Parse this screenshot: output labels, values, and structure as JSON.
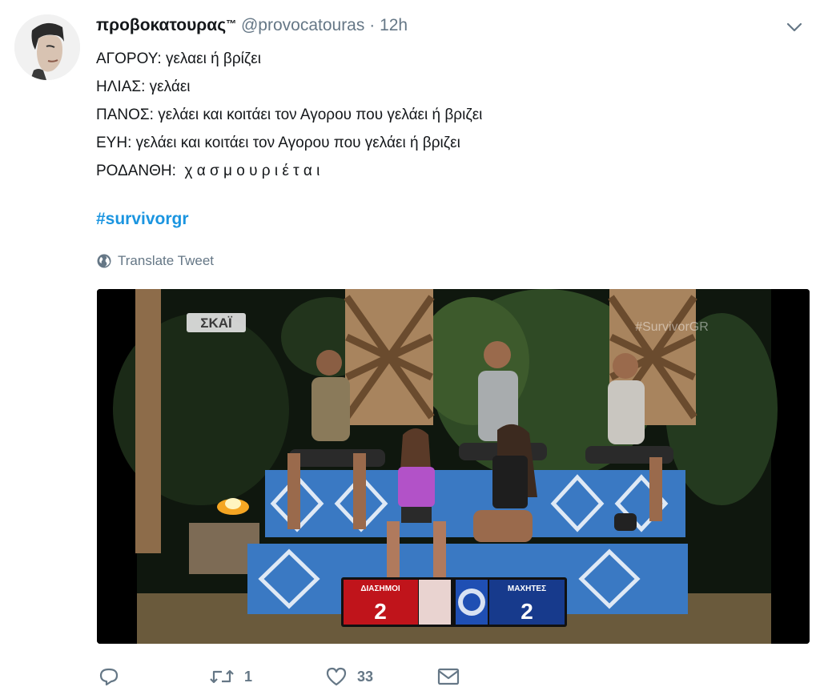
{
  "tweet": {
    "display_name": "προβοκατουρας",
    "trademark": "™",
    "handle": "@provocatouras",
    "separator": "·",
    "time": "12h",
    "lines": [
      "ΑΓΟΡΟΥ: γελαει ή βρίζει",
      "ΗΛΙΑΣ: γελάει",
      "ΠΑΝΟΣ: γελάει και κοιτάει τον Αγορου που γελάει ή βριζει",
      "ΕΥΗ: γελάει και κοιτάει τον Αγορου που γελάει ή βριζει",
      "ΡΟΔΑΝΘΗ:  χ α σ μ ο υ ρ ι έ τ α ι"
    ],
    "hashtag": "#survivorgr",
    "translate_label": "Translate Tweet"
  },
  "media": {
    "channel_logo": "ΣΚΑΪ",
    "watermark": "#SurvivorGR",
    "scoreboard": {
      "left_team": "ΔΙΑΣΗΜΟΙ",
      "left_score": "2",
      "right_team": "ΜΑΧΗΤΕΣ",
      "right_score": "2",
      "left_color": "#c0141b",
      "right_color": "#173a8c"
    }
  },
  "actions": {
    "reply_icon": "reply-icon",
    "retweet_icon": "retweet-icon",
    "retweet_count": "1",
    "like_icon": "heart-icon",
    "like_count": "33",
    "message_icon": "envelope-icon"
  },
  "colors": {
    "link": "#1b95e0",
    "muted": "#657786",
    "text": "#14171a"
  }
}
